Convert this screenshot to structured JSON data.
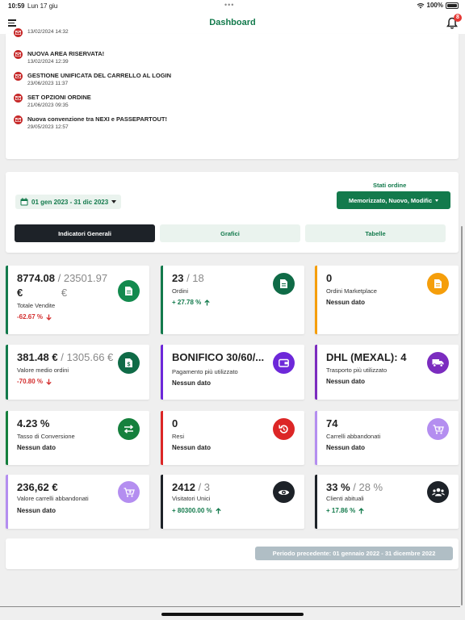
{
  "status_bar": {
    "time": "10:59",
    "date": "Lun 17 giu",
    "dots": "•••",
    "battery": "100%"
  },
  "header": {
    "title": "Dashboard",
    "notifications": "8"
  },
  "news": [
    {
      "title": "",
      "date": "13/02/2024 14:32"
    },
    {
      "title": "NUOVA AREA RISERVATA!",
      "date": "13/02/2024 12:39"
    },
    {
      "title": "GESTIONE UNIFICATA DEL CARRELLO AL LOGIN",
      "date": "23/06/2023 11:37"
    },
    {
      "title": "SET OPZIONI ORDINE",
      "date": "21/06/2023 09:35"
    },
    {
      "title": "Nuova convenzione tra NEXI e PASSEPARTOUT!",
      "date": "29/05/2023 12:57"
    }
  ],
  "filters": {
    "date_range": "01 gen 2023 - 31 dic 2023",
    "stati_label": "Stati ordine",
    "stati_value": "Memorizzato, Nuovo, Modific"
  },
  "tabs": [
    "Indicatori Generali",
    "Grafici",
    "Tabelle"
  ],
  "kpis": [
    {
      "main": "8774.08",
      "main2": "€",
      "sec": "/ 23501.97",
      "sec2": "€",
      "label": "Totale Vendite",
      "change": "-62.67 %",
      "dir": "down",
      "color": "#137a4c",
      "icon": "document-icon"
    },
    {
      "main": "23",
      "sec": " / 18",
      "label": "Ordini",
      "change": "+ 27.78 %",
      "dir": "up",
      "color": "#137a4c",
      "icon": "document-icon"
    },
    {
      "main": "0",
      "sec": "",
      "label": "Ordini Marketplace",
      "change": "Nessun dato",
      "dir": "none",
      "color": "#f59e0b",
      "icon": "document-icon"
    },
    {
      "main": "381.48 €",
      "sec": " / 1305.66 €",
      "label": "Valore medio ordini",
      "change": "-70.80 %",
      "dir": "down",
      "color": "#137a4c",
      "icon": "invoice-icon"
    },
    {
      "main": "BONIFICO 30/60/...",
      "sec": "",
      "label": "Pagamento più utilizzato",
      "change": "Nessun dato",
      "dir": "none",
      "color": "#6d28d9",
      "icon": "wallet-icon"
    },
    {
      "main": "DHL (MEXAL): 4",
      "sec": "",
      "label": "Trasporto più utilizzato",
      "change": "Nessun dato",
      "dir": "none",
      "color": "#7b2cbf",
      "icon": "truck-icon"
    },
    {
      "main": "4.23 %",
      "sec": "",
      "label": "Tasso di Conversione",
      "change": "Nessun dato",
      "dir": "none",
      "color": "#15803d",
      "icon": "swap-icon"
    },
    {
      "main": "0",
      "sec": "",
      "label": "Resi",
      "change": "Nessun dato",
      "dir": "none",
      "color": "#dc2626",
      "icon": "undo-icon"
    },
    {
      "main": "74",
      "sec": "",
      "label": "Carrelli abbandonati",
      "change": "Nessun dato",
      "dir": "none",
      "color": "#b48ef0",
      "icon": "cart-icon"
    },
    {
      "main": "236,62 €",
      "sec": "",
      "label": "Valore carrelli abbandonati",
      "change": "Nessun dato",
      "dir": "none",
      "color": "#b48ef0",
      "icon": "cart-icon"
    },
    {
      "main": "2412",
      "sec": " / 3",
      "label": "Visitatori Unici",
      "change": "+ 80300.00 %",
      "dir": "up",
      "color": "#1d2228",
      "icon": "eye-icon"
    },
    {
      "main": "33 %",
      "sec": " / 28 %",
      "label": "Clienti abituali",
      "change": "+ 17.86 %",
      "dir": "up",
      "color": "#1d2228",
      "icon": "users-icon"
    }
  ],
  "previous_period": "Periodo precedente: 01 gennaio 2022 - 31 dicembre 2022"
}
